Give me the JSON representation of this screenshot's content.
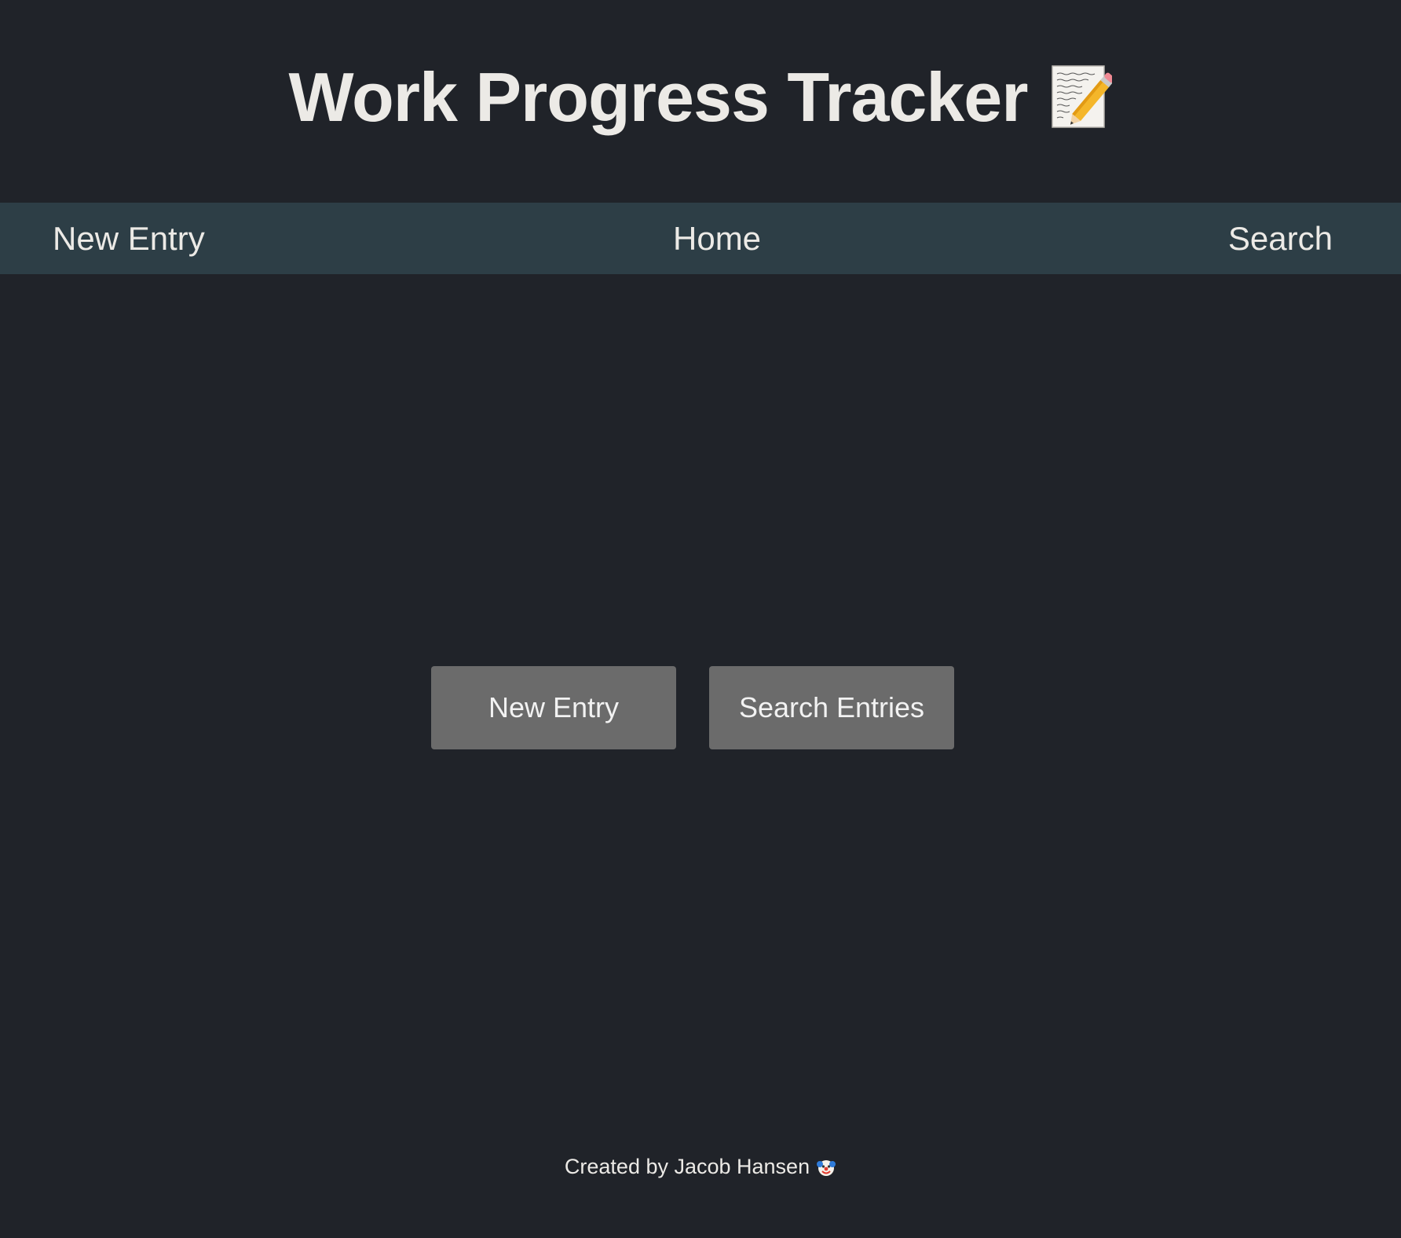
{
  "header": {
    "title": "Work Progress Tracker",
    "title_icon": "memo-icon"
  },
  "nav": {
    "new_entry": "New Entry",
    "home": "Home",
    "search": "Search"
  },
  "main": {
    "new_entry_button": "New Entry",
    "search_entries_button": "Search Entries"
  },
  "footer": {
    "text": "Created by Jacob Hansen",
    "icon": "clown-face-icon"
  },
  "colors": {
    "background": "#202329",
    "navbar": "#2d3e46",
    "button": "#6b6b6b",
    "text": "#eceae6"
  }
}
